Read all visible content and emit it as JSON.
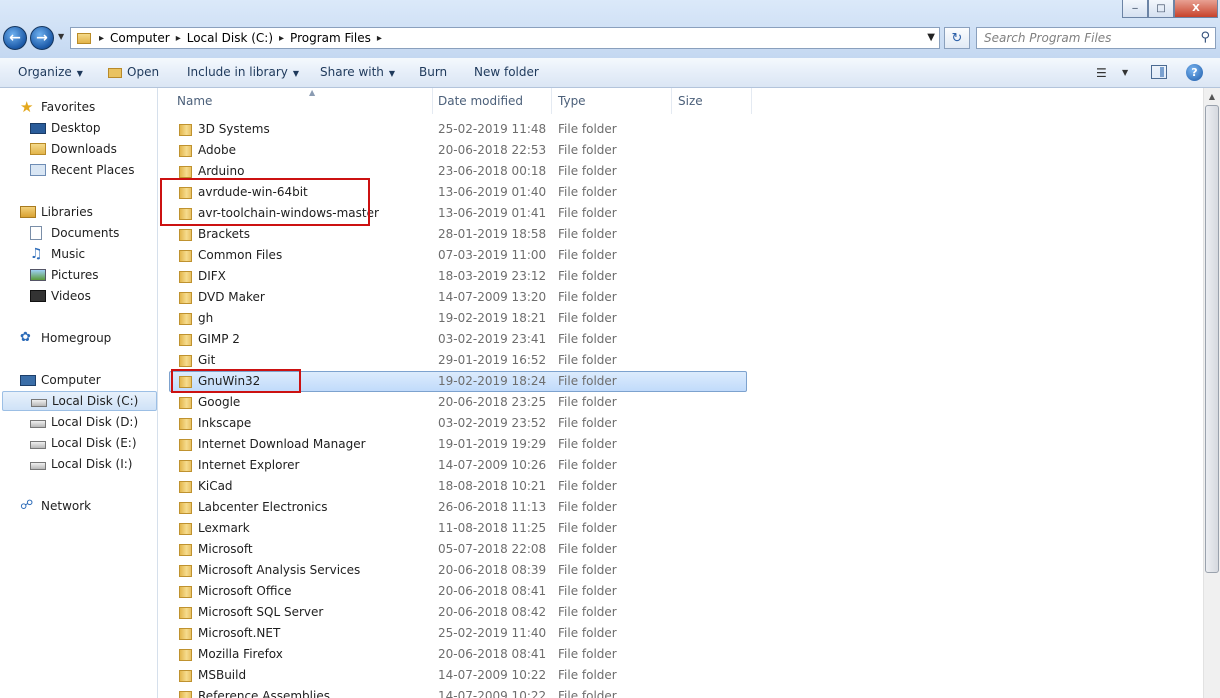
{
  "window": {
    "minimize_glyph": "‒",
    "maximize_glyph": "□",
    "close_glyph": "X"
  },
  "address_bar": {
    "breadcrumbs": [
      "Computer",
      "Local Disk (C:)",
      "Program Files"
    ],
    "separator": "▸",
    "dropdown_glyph": "▼"
  },
  "search": {
    "placeholder": "Search Program Files",
    "icon": "magnifier-icon"
  },
  "toolbar": {
    "organize": "Organize",
    "open": "Open",
    "include_in_library": "Include in library",
    "share_with": "Share with",
    "burn": "Burn",
    "new_folder": "New folder"
  },
  "nav": {
    "favorites": "Favorites",
    "desktop": "Desktop",
    "downloads": "Downloads",
    "recent_places": "Recent Places",
    "libraries": "Libraries",
    "documents": "Documents",
    "music": "Music",
    "pictures": "Pictures",
    "videos": "Videos",
    "homegroup": "Homegroup",
    "computer": "Computer",
    "drive_c": "Local Disk (C:)",
    "drive_d": "Local Disk (D:)",
    "drive_e": "Local Disk (E:)",
    "drive_i": "Local Disk (I:)",
    "network": "Network"
  },
  "columns": {
    "name": "Name",
    "date_modified": "Date modified",
    "type": "Type",
    "size": "Size"
  },
  "files": [
    {
      "name": "3D Systems",
      "date": "25-02-2019 11:48",
      "type": "File folder"
    },
    {
      "name": "Adobe",
      "date": "20-06-2018 22:53",
      "type": "File folder"
    },
    {
      "name": "Arduino",
      "date": "23-06-2018 00:18",
      "type": "File folder"
    },
    {
      "name": "avrdude-win-64bit",
      "date": "13-06-2019 01:40",
      "type": "File folder"
    },
    {
      "name": "avr-toolchain-windows-master",
      "date": "13-06-2019 01:41",
      "type": "File folder"
    },
    {
      "name": "Brackets",
      "date": "28-01-2019 18:58",
      "type": "File folder"
    },
    {
      "name": "Common Files",
      "date": "07-03-2019 11:00",
      "type": "File folder"
    },
    {
      "name": "DIFX",
      "date": "18-03-2019 23:12",
      "type": "File folder"
    },
    {
      "name": "DVD Maker",
      "date": "14-07-2009 13:20",
      "type": "File folder"
    },
    {
      "name": "gh",
      "date": "19-02-2019 18:21",
      "type": "File folder"
    },
    {
      "name": "GIMP 2",
      "date": "03-02-2019 23:41",
      "type": "File folder"
    },
    {
      "name": "Git",
      "date": "29-01-2019 16:52",
      "type": "File folder"
    },
    {
      "name": "GnuWin32",
      "date": "19-02-2019 18:24",
      "type": "File folder"
    },
    {
      "name": "Google",
      "date": "20-06-2018 23:25",
      "type": "File folder"
    },
    {
      "name": "Inkscape",
      "date": "03-02-2019 23:52",
      "type": "File folder"
    },
    {
      "name": "Internet Download Manager",
      "date": "19-01-2019 19:29",
      "type": "File folder"
    },
    {
      "name": "Internet Explorer",
      "date": "14-07-2009 10:26",
      "type": "File folder"
    },
    {
      "name": "KiCad",
      "date": "18-08-2018 10:21",
      "type": "File folder"
    },
    {
      "name": "Labcenter Electronics",
      "date": "26-06-2018 11:13",
      "type": "File folder"
    },
    {
      "name": "Lexmark",
      "date": "11-08-2018 11:25",
      "type": "File folder"
    },
    {
      "name": "Microsoft",
      "date": "05-07-2018 22:08",
      "type": "File folder"
    },
    {
      "name": "Microsoft Analysis Services",
      "date": "20-06-2018 08:39",
      "type": "File folder"
    },
    {
      "name": "Microsoft Office",
      "date": "20-06-2018 08:41",
      "type": "File folder"
    },
    {
      "name": "Microsoft SQL Server",
      "date": "20-06-2018 08:42",
      "type": "File folder"
    },
    {
      "name": "Microsoft.NET",
      "date": "25-02-2019 11:40",
      "type": "File folder"
    },
    {
      "name": "Mozilla Firefox",
      "date": "20-06-2018 08:41",
      "type": "File folder"
    },
    {
      "name": "MSBuild",
      "date": "14-07-2009 10:22",
      "type": "File folder"
    },
    {
      "name": "Reference Assemblies",
      "date": "14-07-2009 10:22",
      "type": "File folder"
    }
  ],
  "selected_file": "GnuWin32",
  "highlighted_files": [
    "avrdude-win-64bit",
    "avr-toolchain-windows-master",
    "GnuWin32"
  ],
  "colors": {
    "highlight_box": "#cc1111",
    "selection": "#cce0f8"
  }
}
